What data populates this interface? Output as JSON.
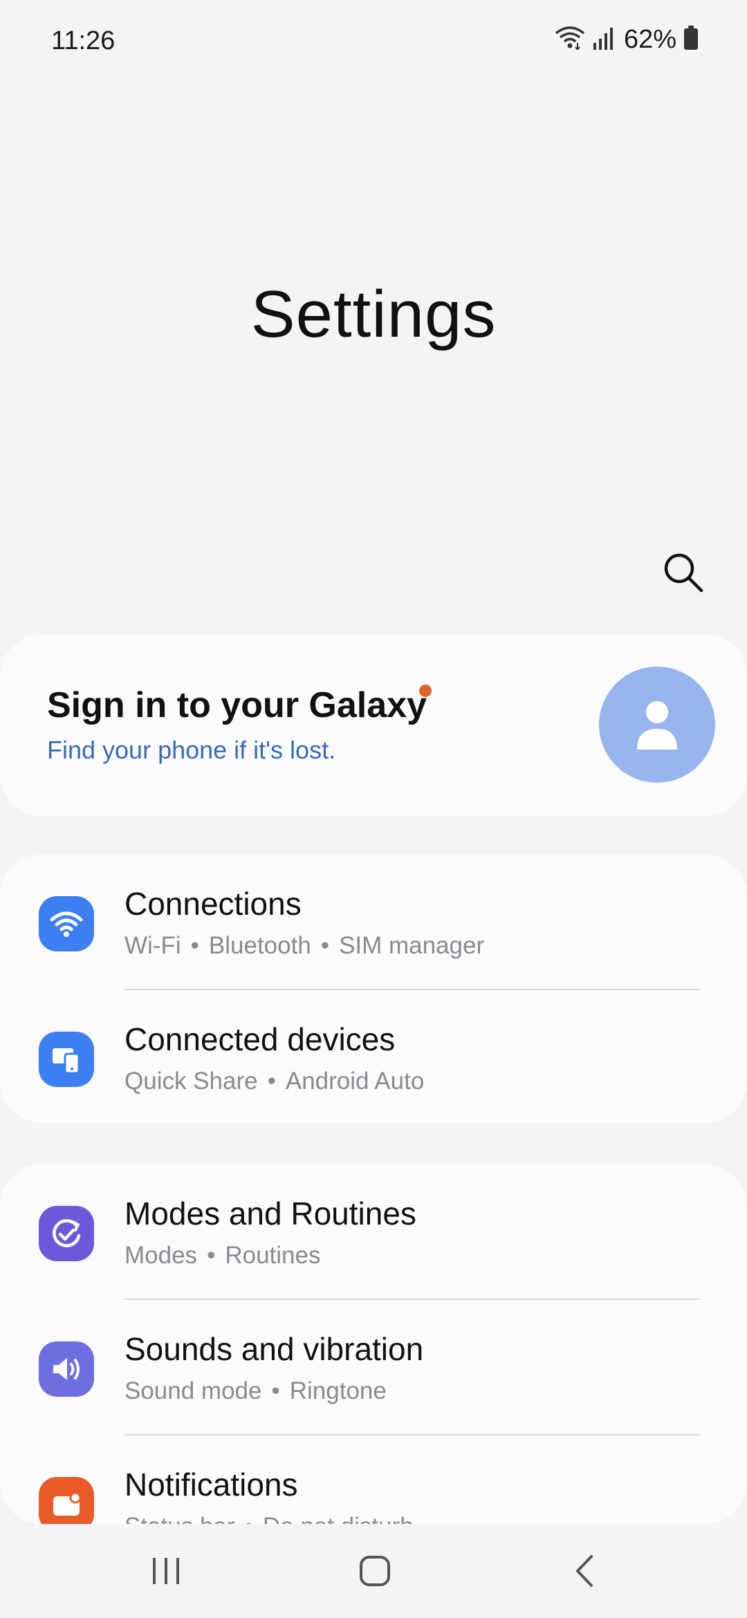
{
  "status_bar": {
    "time": "11:26",
    "battery_percent": "62%",
    "icons": [
      "wifi-icon",
      "signal-icon",
      "battery-icon"
    ]
  },
  "header": {
    "title": "Settings",
    "search_icon": "search-icon"
  },
  "account": {
    "title": "Sign in to your Galaxy",
    "subtitle": "Find your phone if it's lost.",
    "badge_color": "#e0642a",
    "avatar_color": "#97b4ee"
  },
  "groups": [
    {
      "items": [
        {
          "title": "Connections",
          "icon": "wifi-icon",
          "icon_color": "#3d7ff1",
          "subtitles": [
            "Wi-Fi",
            "Bluetooth",
            "SIM manager"
          ]
        },
        {
          "title": "Connected devices",
          "icon": "devices-icon",
          "icon_color": "#3d7ff1",
          "subtitles": [
            "Quick Share",
            "Android Auto"
          ]
        }
      ]
    },
    {
      "items": [
        {
          "title": "Modes and Routines",
          "icon": "routines-icon",
          "icon_color": "#6c58d8",
          "subtitles": [
            "Modes",
            "Routines"
          ]
        },
        {
          "title": "Sounds and vibration",
          "icon": "speaker-icon",
          "icon_color": "#6d6ee0",
          "subtitles": [
            "Sound mode",
            "Ringtone"
          ]
        },
        {
          "title": "Notifications",
          "icon": "notification-icon",
          "icon_color": "#ea5b2a",
          "subtitles": [
            "Status bar",
            "Do not disturb"
          ]
        }
      ]
    }
  ],
  "nav_bar": {
    "recents": "recents-icon",
    "home": "home-icon",
    "back": "back-icon"
  }
}
